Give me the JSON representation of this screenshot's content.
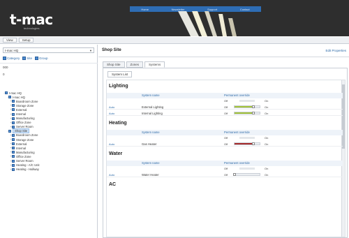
{
  "banner": {
    "logo": "t-mac",
    "tagline": "technologies",
    "nav": [
      "Home",
      "Newsletter",
      "Support",
      "Contact"
    ]
  },
  "menubar": {
    "items": [
      "View",
      "Setup"
    ]
  },
  "leftpane": {
    "site_select": "t-mac HQ",
    "toolbar": [
      "Category",
      "Site",
      "Group"
    ],
    "label_a": "000",
    "label_b": "0",
    "tree": [
      {
        "label": "t-mac HQ",
        "level": 0,
        "exp": "-"
      },
      {
        "label": "t-mac HQ",
        "level": 1,
        "exp": "-"
      },
      {
        "label": "Boardroom Zone",
        "level": 2,
        "exp": "+"
      },
      {
        "label": "Storage Zone",
        "level": 2,
        "exp": "+"
      },
      {
        "label": "External",
        "level": 2,
        "exp": "+"
      },
      {
        "label": "Internal",
        "level": 2,
        "exp": "+"
      },
      {
        "label": "Manufacturing",
        "level": 2,
        "exp": "+"
      },
      {
        "label": "Office Zone",
        "level": 2,
        "exp": "+"
      },
      {
        "label": "Server Room",
        "level": 2,
        "exp": "+"
      },
      {
        "label": "Shop Site",
        "level": 1,
        "exp": "-",
        "selected": true
      },
      {
        "label": "Boardroom Zone",
        "level": 2,
        "exp": "+"
      },
      {
        "label": "Storage Zone",
        "level": 2,
        "exp": "+"
      },
      {
        "label": "External",
        "level": 2,
        "exp": "+"
      },
      {
        "label": "Internal",
        "level": 2,
        "exp": "+"
      },
      {
        "label": "Manufacturing",
        "level": 2,
        "exp": "+"
      },
      {
        "label": "Office Zone",
        "level": 2,
        "exp": "+"
      },
      {
        "label": "Server Room",
        "level": 2,
        "exp": "+"
      },
      {
        "label": "Heating - A/C Unit",
        "level": 2,
        "exp": "+"
      },
      {
        "label": "Heating - Hallway",
        "level": 2,
        "exp": "+"
      }
    ]
  },
  "main": {
    "title": "Shop Site",
    "top_link": "Edit Properties",
    "tabs": [
      "Shop Site",
      "Zones",
      "Systems"
    ],
    "active_tab": 2,
    "subtab": "System List",
    "sections": [
      {
        "heading": "Lighting",
        "col_name": "System name",
        "col_override": "Permanent override",
        "off": "Off",
        "on": "On",
        "rows": [
          {
            "status": "Auto",
            "name": "External Lighting",
            "off": "Off",
            "on": "On",
            "level": 0.75,
            "color": "#a4c43a"
          },
          {
            "status": "Auto",
            "name": "Internal Lighting",
            "off": "Off",
            "on": "On",
            "level": 0.75,
            "color": "#a4c43a"
          }
        ]
      },
      {
        "heading": "Heating",
        "col_name": "System name",
        "col_override": "Permanent override",
        "off": "Off",
        "on": "On",
        "rows": [
          {
            "status": "Auto",
            "name": "Gas Heater",
            "off": "Off",
            "on": "On",
            "level": 0.75,
            "color": "#a52a2a"
          }
        ]
      },
      {
        "heading": "Water",
        "col_name": "System name",
        "col_override": "Permanent override",
        "off": "Off",
        "on": "On",
        "rows": [
          {
            "status": "Auto",
            "name": "Water Heater",
            "off": "Off",
            "on": "On",
            "level": 0.0,
            "color": "#cccccc"
          }
        ]
      }
    ],
    "last_heading": "AC"
  }
}
